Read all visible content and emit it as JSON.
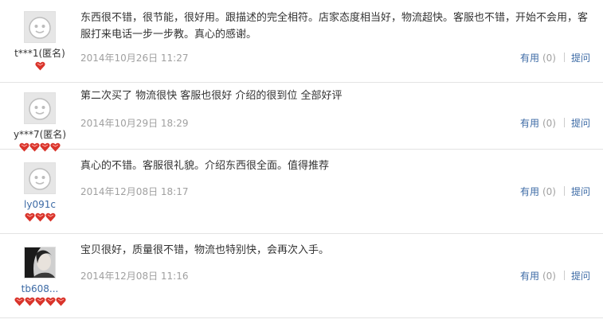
{
  "reviews": [
    {
      "user": "t***1(匿名)",
      "anonymous": true,
      "avatar": "default-avatar",
      "hearts": 1,
      "content": "东西很不错，很节能，很好用。跟描述的完全相符。店家态度相当好，物流超快。客服也不错，开始不会用，客服打来电话一步一步教。真心的感谢。",
      "date": "2014年10月26日 11:27",
      "useful_label": "有用",
      "useful_count": "(0)",
      "ask_label": "提问"
    },
    {
      "user": "y***7(匿名)",
      "anonymous": true,
      "avatar": "default-avatar",
      "hearts": 4,
      "content": "第二次买了 物流很快 客服也很好 介绍的很到位 全部好评",
      "date": "2014年10月29日 18:29",
      "useful_label": "有用",
      "useful_count": "(0)",
      "ask_label": "提问"
    },
    {
      "user": "ly091c",
      "anonymous": false,
      "avatar": "default-avatar",
      "hearts": 3,
      "content": "真心的不错。客服很礼貌。介绍东西很全面。值得推荐",
      "date": "2014年12月08日 18:17",
      "useful_label": "有用",
      "useful_count": "(0)",
      "ask_label": "提问"
    },
    {
      "user": "tb608...",
      "anonymous": false,
      "avatar": "photo-avatar",
      "hearts": 5,
      "content": "宝贝很好，质量很不错，物流也特别快，会再次入手。",
      "date": "2014年12月08日 11:16",
      "useful_label": "有用",
      "useful_count": "(0)",
      "ask_label": "提问"
    }
  ],
  "colors": {
    "link": "#3c6aa5",
    "meta": "#a0a0a0",
    "heart": "#d9342b",
    "divider": "#e3e3e3"
  }
}
